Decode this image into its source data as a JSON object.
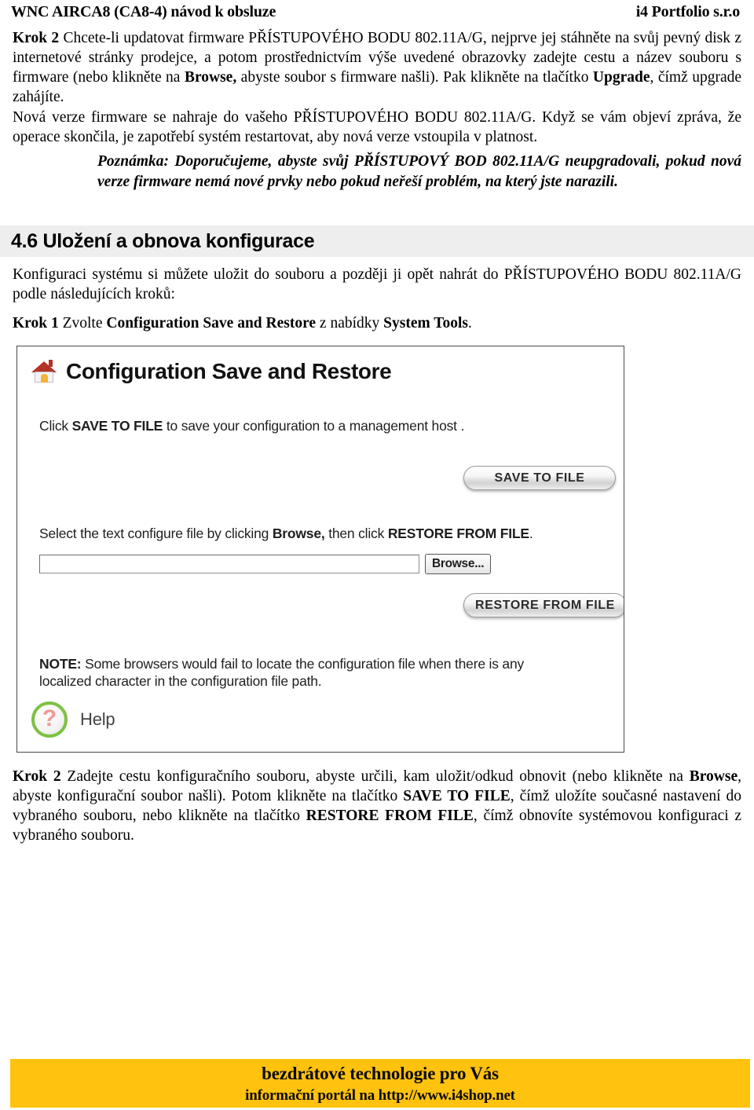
{
  "header": {
    "left": "WNC AIRCA8 (CA8-4) návod k obsluze",
    "right": "i4 Portfolio s.r.o"
  },
  "step2_firmware": {
    "label": "Krok 2",
    "text_1": " Chcete-li updatovat firmware PŘÍSTUPOVÉHO BODU 802.11A/G, nejprve jej stáhněte na svůj pevný disk z internetové stránky prodejce, a potom prostřednictvím výše uvedené obrazovky zadejte cestu a název souboru s firmware (nebo klikněte na ",
    "bold_browse": "Browse,",
    "text_2": " abyste soubor s firmware našli). Pak klikněte na tlačítko ",
    "bold_upgrade": "Upgrade",
    "text_3": ", čímž upgrade zahájíte."
  },
  "paragraph_firmware_result": "Nová verze firmware se nahraje do vašeho PŘÍSTUPOVÉHO BODU 802.11A/G. Když se vám objeví zpráva, že operace skončila, je zapotřebí systém restartovat, aby nová verze vstoupila v platnost.",
  "note": "Poznámka: Doporučujeme, abyste svůj PŘÍSTUPOVÝ BOD 802.11A/G neupgradovali, pokud nová verze firmware nemá nové prvky nebo pokud neřeší problém, na který jste narazili.",
  "section": {
    "heading": "4.6 Uložení a obnova konfigurace",
    "intro": "Konfiguraci systému si můžete uložit do souboru a později ji opět nahrát do PŘÍSTUPOVÉHO BODU 802.11A/G podle následujících kroků:"
  },
  "step1": {
    "label": "Krok 1",
    "text_1": " Zvolte ",
    "bold_menu_item": "Configuration Save and Restore",
    "text_2": " z nabídky ",
    "bold_menu": "System Tools",
    "text_3": "."
  },
  "screenshot": {
    "title": "Configuration Save and Restore",
    "home_icon": "home-icon",
    "save_line": {
      "prefix": "Click ",
      "bold": "SAVE TO FILE",
      "suffix": " to save your configuration to a management host ."
    },
    "save_button": "SAVE TO FILE",
    "select_line": {
      "prefix": "Select the text configure file by clicking ",
      "bold_browse": "Browse,",
      "middle": " then click ",
      "bold_restore": "RESTORE FROM FILE",
      "suffix": "."
    },
    "file_input_value": "",
    "file_input_placeholder": "",
    "browse_button": "Browse...",
    "restore_button": "RESTORE FROM FILE",
    "note_line": {
      "bold": "NOTE:",
      "text": " Some browsers would fail to locate the configuration file when there is any localized character in the configuration file path."
    },
    "help_label": "Help",
    "help_icon": "question-mark-icon"
  },
  "step2_config": {
    "label": "Krok 2",
    "text_1": " Zadejte cestu konfiguračního souboru, abyste určili, kam uložit/odkud obnovit (nebo klikněte na ",
    "bold_browse": "Browse",
    "text_2": ", abyste konfigurační soubor našli). Potom klikněte na tlačítko ",
    "bold_save": "SAVE TO FILE",
    "text_3": ", čímž uložíte současné nastavení do vybraného souboru, nebo klikněte na tlačítko ",
    "bold_restore": "RESTORE FROM FILE",
    "text_4": ", čímž obnovíte systémovou konfiguraci z vybraného souboru."
  },
  "footer": {
    "line1": "bezdrátové technologie pro Vás",
    "line2": "informační portál na http://www.i4shop.net",
    "background_color": "#FFC20E"
  }
}
